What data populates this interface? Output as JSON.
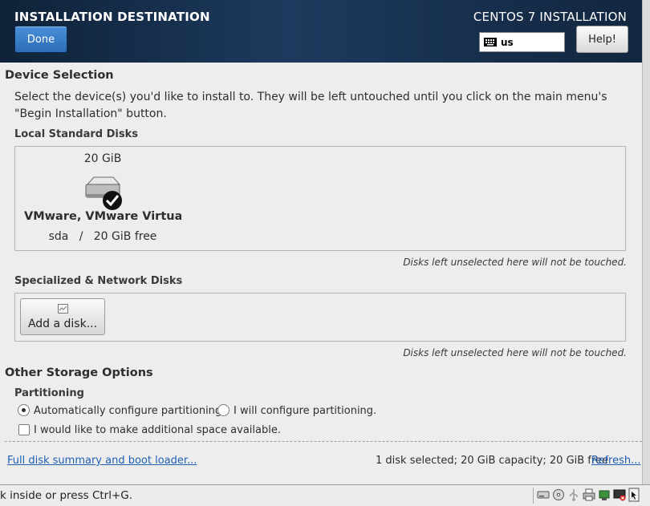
{
  "header": {
    "title": "INSTALLATION DESTINATION",
    "product": "CENTOS 7 INSTALLATION",
    "done_label": "Done",
    "keyboard_layout": "us",
    "help_label": "Help!"
  },
  "device_selection": {
    "heading": "Device Selection",
    "description_line1": "Select the device(s) you'd like to install to.  They will be left untouched until you click on the main menu's",
    "description_line2": "\"Begin Installation\" button.",
    "local_disks_label": "Local Standard Disks",
    "disks": [
      {
        "size": "20 GiB",
        "name": "VMware, VMware Virtual S",
        "info": "sda   /   20 GiB free",
        "selected": true
      }
    ],
    "local_note": "Disks left unselected here will not be touched.",
    "network_disks_label": "Specialized & Network Disks",
    "add_disk_label": "Add a disk...",
    "network_note": "Disks left unselected here will not be touched."
  },
  "other_storage": {
    "heading": "Other Storage Options",
    "partitioning_label": "Partitioning",
    "auto_partition_label": "Automatically configure partitioning.",
    "manual_partition_label": "I will configure partitioning.",
    "auto_selected": true,
    "additional_space_label": "I would like to make additional space available.",
    "additional_space_checked": false
  },
  "footer": {
    "summary_link": "Full disk summary and boot loader...",
    "summary_text": "1 disk selected; 20 GiB capacity; 20 GiB free",
    "refresh_link": "Refresh..."
  },
  "statusbar": {
    "text": "k inside or press Ctrl+G.",
    "icons": [
      "hard-disk-icon",
      "cd-drive-icon",
      "usb-icon",
      "printer-icon",
      "network-icon",
      "display-icon",
      "mouse-icon"
    ]
  }
}
